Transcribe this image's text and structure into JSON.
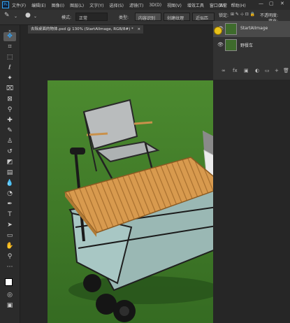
{
  "menubar": {
    "app_icon": "Ps",
    "items": [
      "文件(F)",
      "编辑(E)",
      "图像(I)",
      "图层(L)",
      "文字(Y)",
      "选择(S)",
      "滤镜(T)",
      "3D(D)",
      "视图(V)",
      "增效工具",
      "窗口(W)",
      "帮助(H)"
    ],
    "right_text": "正常"
  },
  "options": {
    "mode_label": "模式:",
    "mode_value": "正常",
    "type_label": "类型:",
    "type_btn1": "内容识别",
    "type_btn2": "创建纹理",
    "type_btn3": "近似匹配",
    "lock_label": "锁定:",
    "opacity_label": "不透明度:",
    "fill_label": "填充:"
  },
  "tab": {
    "label": "去除桌面的物体.psd @ 130% (StartAIImage, RGB/8#) *",
    "close": "×"
  },
  "layers": {
    "items": [
      {
        "name": "StartAIImage",
        "visible": true
      },
      {
        "name": "野餐车",
        "visible": true
      }
    ],
    "buttons": [
      "∞",
      "fx",
      "▣",
      "◐",
      "▭",
      "+",
      "🗑"
    ]
  },
  "colors": {
    "accent": "#31a8ff",
    "grass": "#3e7a2a",
    "table_top": "#d89a4e"
  },
  "tools": [
    "move-tool",
    "artboard-tool",
    "marquee-tool",
    "lasso-tool",
    "magic-wand-tool",
    "crop-tool",
    "frame-tool",
    "eyedropper-tool",
    "healing-brush-tool",
    "brush-tool",
    "clone-stamp-tool",
    "history-brush-tool",
    "eraser-tool",
    "gradient-tool",
    "blur-tool",
    "dodge-tool",
    "pen-tool",
    "type-tool",
    "path-selection-tool",
    "rectangle-tool",
    "hand-tool",
    "zoom-tool"
  ]
}
